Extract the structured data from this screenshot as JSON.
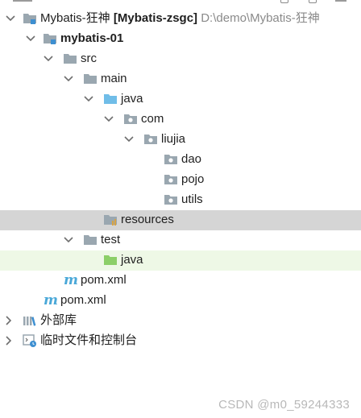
{
  "tree": {
    "root": {
      "label": "Mybatis-狂神",
      "module_tag": "[Mybatis-zsgc]",
      "path": "D:\\demo\\Mybatis-狂神"
    },
    "module": {
      "label": "mybatis-01"
    },
    "src": {
      "label": "src"
    },
    "main": {
      "label": "main"
    },
    "java_main": {
      "label": "java"
    },
    "com": {
      "label": "com"
    },
    "liujia": {
      "label": "liujia"
    },
    "dao": {
      "label": "dao"
    },
    "pojo": {
      "label": "pojo"
    },
    "utils": {
      "label": "utils"
    },
    "resources": {
      "label": "resources"
    },
    "test": {
      "label": "test"
    },
    "java_test": {
      "label": "java"
    },
    "module_pom": {
      "label": "pom.xml"
    },
    "root_pom": {
      "label": "pom.xml"
    },
    "external_libs": {
      "label": "外部库"
    },
    "scratches": {
      "label": "临时文件和控制台"
    }
  },
  "watermark": "CSDN @m0_59244333",
  "colors": {
    "folder": "#9aa7b0",
    "source_folder": "#70bde8",
    "test_folder": "#8ccf68",
    "selected_row": "#d5d5d5",
    "highlight_row": "#eef8e6",
    "maven_icon": "#4aa8d8"
  }
}
